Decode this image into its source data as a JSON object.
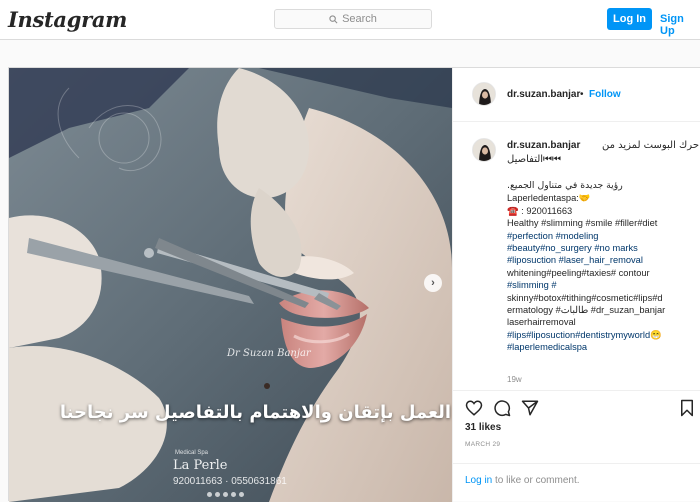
{
  "header": {
    "logo": "Instagram",
    "search_placeholder": "Search",
    "login_label": "Log In",
    "signup_label": "Sign Up"
  },
  "media": {
    "overlay_text": "العمل بإتقان والاهتمام بالتفاصيل سر نجاحنا",
    "signature": "Dr Suzan Banjar",
    "brand_small": "Medical Spa",
    "brand": "La Perle",
    "phone": "920011663 · 0550631861",
    "next_icon": "chevron-right-icon"
  },
  "post_header": {
    "username": "dr.suzan.banjar",
    "separator": "•",
    "follow_label": "Follow"
  },
  "caption": {
    "username": "dr.suzan.banjar",
    "first_line": "حرك البوست لمزيد من",
    "second_line": "التفاصيل⏮⏮",
    "lines": [
      {
        "text": "رؤية جديدة في متناول الجميع.",
        "type": "rtl"
      },
      {
        "text": "Laperledentaspa:🤝",
        "type": "plain"
      },
      {
        "text": "☎️ : 920011663",
        "type": "plain"
      },
      {
        "text": "Healthy  #slimming #smile #filler#diet",
        "type": "mixed"
      },
      {
        "text": "#perfection #modeling",
        "type": "tag"
      },
      {
        "text": "#beauty#no_surgery #no marks",
        "type": "tag"
      },
      {
        "text": "#liposuction #laser_hair_removal",
        "type": "tag"
      },
      {
        "text": "whitening#peeling#taxies# contour",
        "type": "mixed"
      },
      {
        "text": "#slimming #",
        "type": "tag"
      },
      {
        "text": "skinny#botox#tithing#cosmetic#lips#d",
        "type": "mixed"
      },
      {
        "text": "ermatology #طالبات #dr_suzan_banjar",
        "type": "mixed"
      },
      {
        "text": "laserhairremoval",
        "type": "plain"
      },
      {
        "text": "#lips#liposuction#dentistrymyworld😁",
        "type": "tag"
      },
      {
        "text": "#laperlemedicalspa",
        "type": "tag"
      }
    ],
    "age": "19w"
  },
  "actions": {
    "like_icon": "heart-icon",
    "comment_icon": "comment-icon",
    "share_icon": "share-icon",
    "save_icon": "bookmark-icon",
    "likes": "31 likes",
    "date": "MARCH 29"
  },
  "comment": {
    "login_link": "Log in",
    "rest": " to like or comment."
  },
  "colors": {
    "accent": "#0095f6",
    "hashtag": "#00376b",
    "muted": "#8e8e8e",
    "border": "#dbdbdb"
  }
}
